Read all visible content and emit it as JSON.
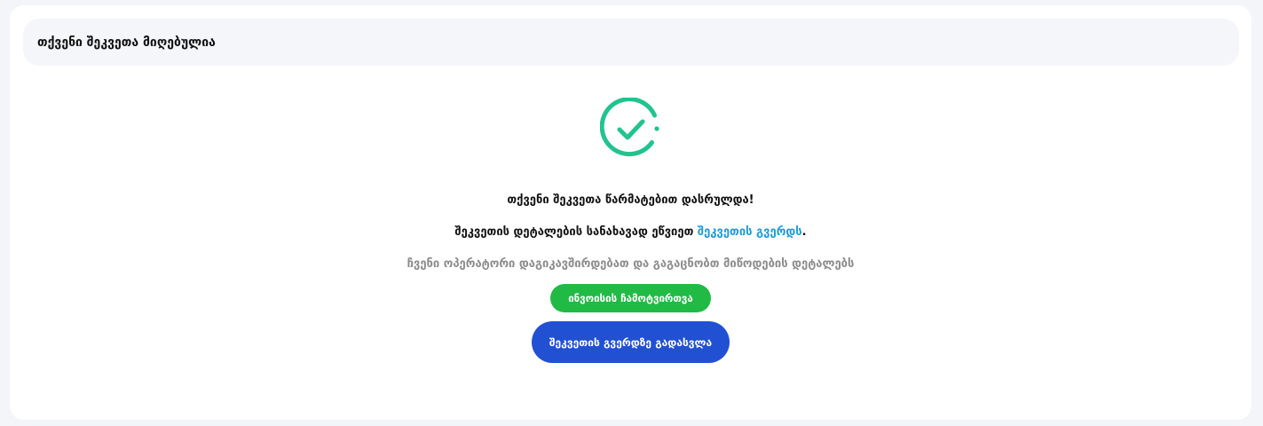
{
  "header": {
    "title": "თქვენი შეკვეთა მიღებულია"
  },
  "success": {
    "icon": "check-circle-icon",
    "icon_color": "#22c38e"
  },
  "messages": {
    "completed": "თქვენი შეკვეთა წარმატებით დასრულდა!",
    "details_prefix": "შეკვეთის დეტალების სანახავად ეწვიეთ ",
    "details_link": "შეკვეთის გვერდს",
    "details_suffix": ".",
    "operator_note": "ჩვენი ოპერატორი დაგიკავშირდებათ და გაგაცნობთ მიწოდების დეტალებს"
  },
  "buttons": {
    "invoice_label": "ინვოისის ჩამოტვირთვა",
    "order_page_label": "შეკვეთის გვერდზე გადასვლა"
  },
  "colors": {
    "invoice_button": "#21ba45",
    "order_button": "#2150d2",
    "link": "#1e9bd7"
  }
}
